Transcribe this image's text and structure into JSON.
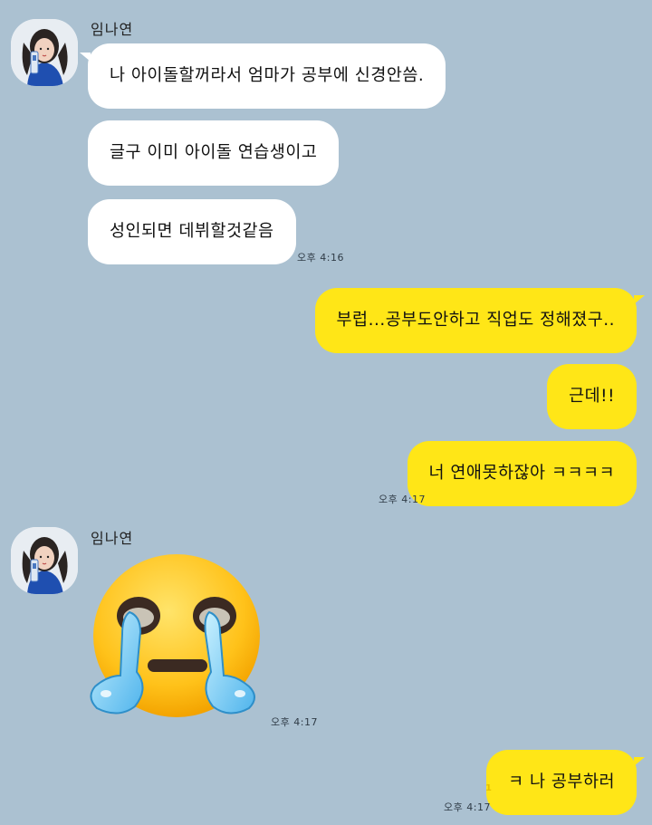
{
  "chat": {
    "colors": {
      "background": "#abc1d1",
      "incoming_bubble": "#ffffff",
      "outgoing_bubble": "#ffe617"
    },
    "group1": {
      "sender": "임나연",
      "avatar_icon": "profile-photo",
      "messages": [
        "나 아이돌할꺼라서 엄마가 공부에 신경안씀.",
        "글구 이미 아이돌 연습생이고",
        "성인되면 데뷔할것같음"
      ],
      "time": "오후 4:16"
    },
    "group2": {
      "messages": [
        "부럽...공부도안하고 직업도 정해졌구..",
        "근데!!",
        "너 연애못하잖아 ㅋㅋㅋㅋ"
      ],
      "time": "오후 4:17"
    },
    "group3": {
      "sender": "임나연",
      "avatar_icon": "profile-photo",
      "emoticon": "crying-face-emoji",
      "time": "오후 4:17"
    },
    "group4": {
      "messages": [
        "ㅋ 나 공부하러"
      ],
      "unread": "1",
      "time": "오후 4:17"
    }
  }
}
